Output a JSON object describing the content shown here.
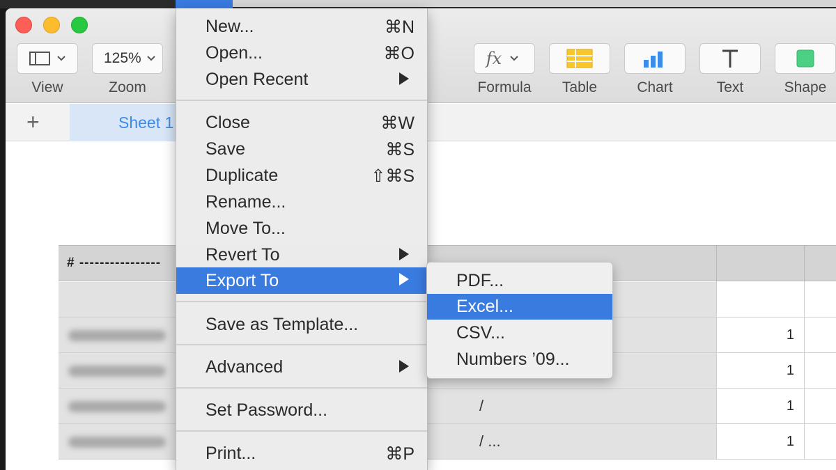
{
  "toolbar": {
    "view_label": "View",
    "zoom_value": "125%",
    "zoom_label": "Zoom",
    "formula_label": "Formula",
    "table_label": "Table",
    "chart_label": "Chart",
    "text_label": "Text",
    "shape_label": "Shape"
  },
  "sheet": {
    "add_label": "+",
    "tab_label": "Sheet 1"
  },
  "table": {
    "header_hash": "# ----------------",
    "rows": [
      {
        "value": "1",
        "text": ""
      },
      {
        "value": "1",
        "text": ""
      },
      {
        "value": "1",
        "text": "/"
      },
      {
        "value": "1",
        "text": "/ ..."
      }
    ]
  },
  "file_menu": {
    "items": [
      {
        "label": "New...",
        "shortcut": "⌘N"
      },
      {
        "label": "Open...",
        "shortcut": "⌘O"
      },
      {
        "label": "Open Recent",
        "shortcut": ""
      },
      {
        "label": "Close",
        "shortcut": "⌘W"
      },
      {
        "label": "Save",
        "shortcut": "⌘S"
      },
      {
        "label": "Duplicate",
        "shortcut": "⇧⌘S"
      },
      {
        "label": "Rename...",
        "shortcut": ""
      },
      {
        "label": "Move To...",
        "shortcut": ""
      },
      {
        "label": "Revert To",
        "shortcut": ""
      },
      {
        "label": "Export To",
        "shortcut": ""
      },
      {
        "label": "Save as Template...",
        "shortcut": ""
      },
      {
        "label": "Advanced",
        "shortcut": ""
      },
      {
        "label": "Set Password...",
        "shortcut": ""
      },
      {
        "label": "Print...",
        "shortcut": "⌘P"
      }
    ]
  },
  "export_submenu": {
    "items": [
      "PDF...",
      "Excel...",
      "CSV...",
      "Numbers ’09..."
    ]
  },
  "colors": {
    "highlight": "#3a7be0",
    "sheet_tab_text": "#3d8be8"
  }
}
